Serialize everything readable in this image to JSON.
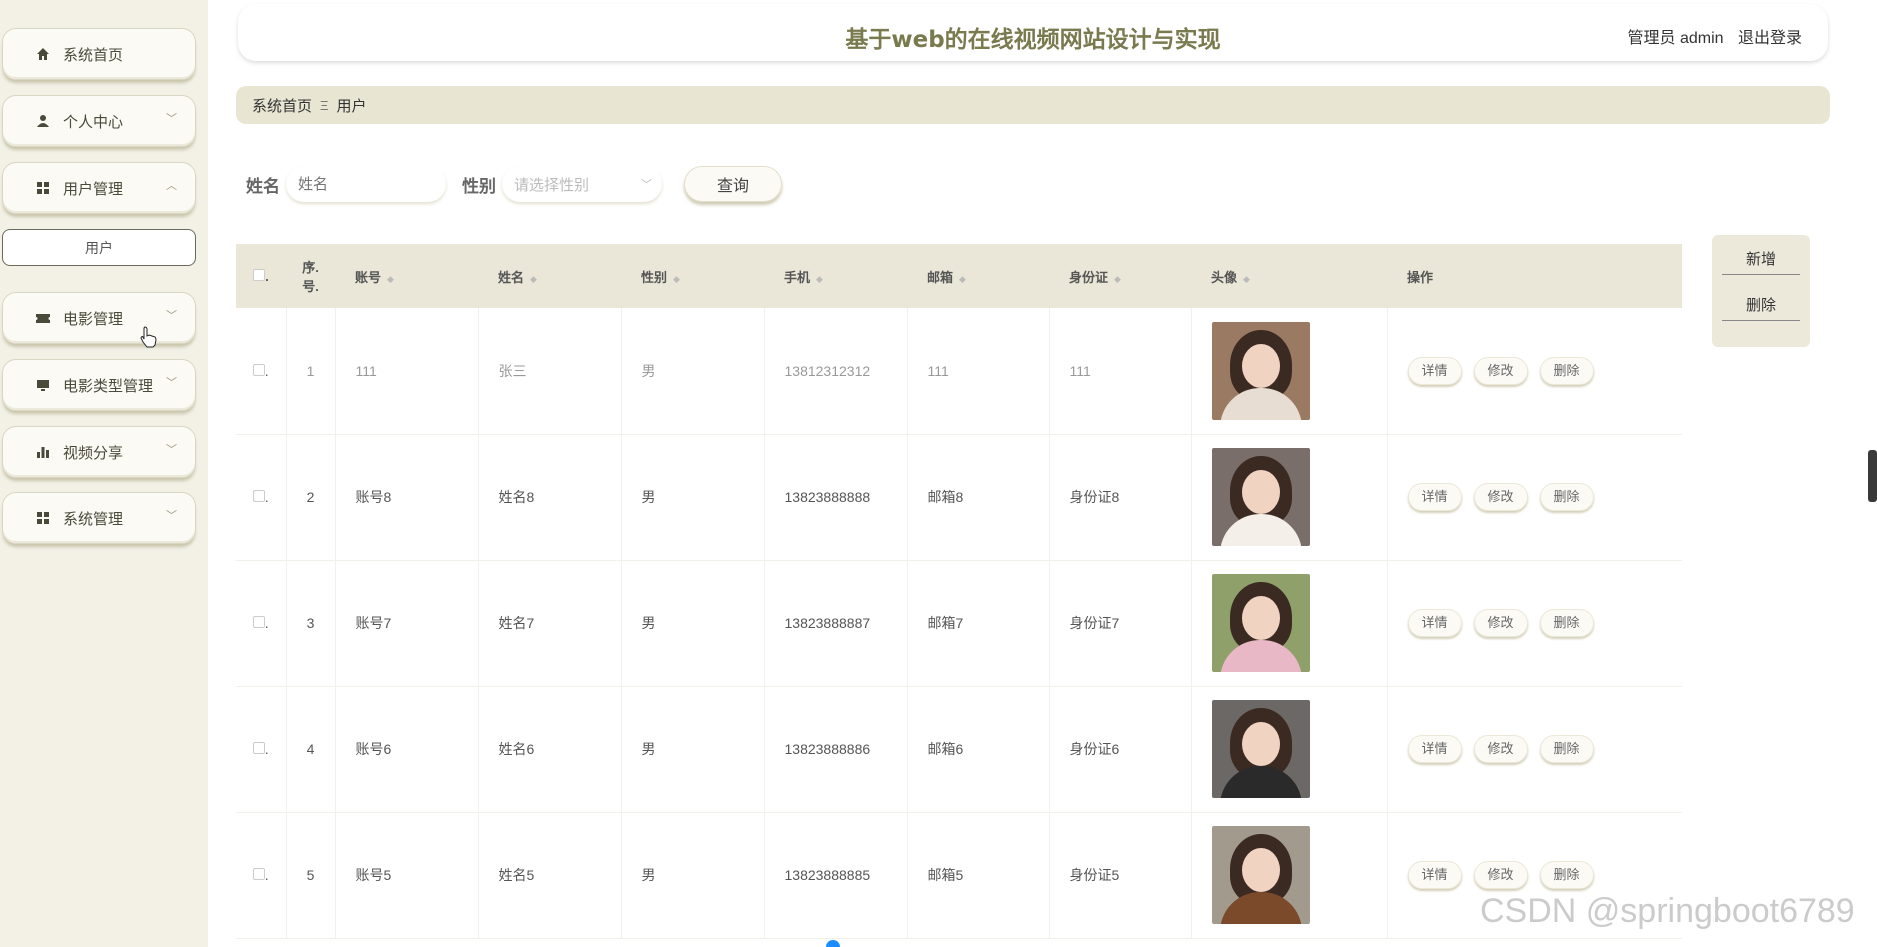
{
  "sidebar": {
    "items": [
      {
        "label": "系统首页",
        "icon": "home-icon"
      },
      {
        "label": "个人中心",
        "icon": "user-icon",
        "arrow": "﹀"
      },
      {
        "label": "用户管理",
        "icon": "grid-icon",
        "arrow": "︿"
      },
      {
        "label": "电影管理",
        "icon": "ticket-icon",
        "arrow": "﹀"
      },
      {
        "label": "电影类型管理",
        "icon": "monitor-icon",
        "arrow": "﹀"
      },
      {
        "label": "视频分享",
        "icon": "bar-chart-icon",
        "arrow": "﹀"
      },
      {
        "label": "系统管理",
        "icon": "grid-icon",
        "arrow": "﹀"
      }
    ],
    "submenu": {
      "label": "用户"
    }
  },
  "header": {
    "title": "基于web的在线视频网站设计与实现",
    "user_label": "管理员 admin",
    "logout": "退出登录"
  },
  "breadcrumb": {
    "home": "系统首页",
    "separator": "Ξ",
    "current": "用户"
  },
  "search": {
    "name_label": "姓名",
    "name_placeholder": "姓名",
    "gender_label": "性别",
    "gender_placeholder": "请选择性别",
    "query_button": "查询"
  },
  "side_actions": {
    "add": "新增",
    "delete": "删除"
  },
  "table": {
    "headers": [
      "序号.",
      "账号",
      "姓名",
      "性别",
      "手机",
      "邮箱",
      "身份证",
      "头像",
      "操作"
    ],
    "idx_header_top": "序.",
    "idx_header_bottom": "号.",
    "check_dot": ".",
    "rows": [
      {
        "idx": "1",
        "account": "111",
        "name": "张三",
        "gender": "男",
        "phone": "13812312312",
        "email": "111",
        "id_card": "111",
        "avatar_bg": "#9b7a63",
        "avatar_body": "#e8ddd2"
      },
      {
        "idx": "2",
        "account": "账号8",
        "name": "姓名8",
        "gender": "男",
        "phone": "13823888888",
        "email": "邮箱8",
        "id_card": "身份证8",
        "avatar_bg": "#7a6e6a",
        "avatar_body": "#f4efe9"
      },
      {
        "idx": "3",
        "account": "账号7",
        "name": "姓名7",
        "gender": "男",
        "phone": "13823888887",
        "email": "邮箱7",
        "id_card": "身份证7",
        "avatar_bg": "#8fa06a",
        "avatar_body": "#e9b8c6"
      },
      {
        "idx": "4",
        "account": "账号6",
        "name": "姓名6",
        "gender": "男",
        "phone": "13823888886",
        "email": "邮箱6",
        "id_card": "身份证6",
        "avatar_bg": "#6b6866",
        "avatar_body": "#2a2a2a"
      },
      {
        "idx": "5",
        "account": "账号5",
        "name": "姓名5",
        "gender": "男",
        "phone": "13823888885",
        "email": "邮箱5",
        "id_card": "身份证5",
        "avatar_bg": "#a39a8e",
        "avatar_body": "#7a4a2a"
      }
    ],
    "ops": {
      "detail": "详情",
      "edit": "修改",
      "delete": "删除"
    }
  },
  "watermark": "CSDN @springboot6789",
  "colors": {
    "accent": "#7a7a4f",
    "sidebar_bg": "#f3f1e6",
    "header_band": "#eae7d8"
  }
}
